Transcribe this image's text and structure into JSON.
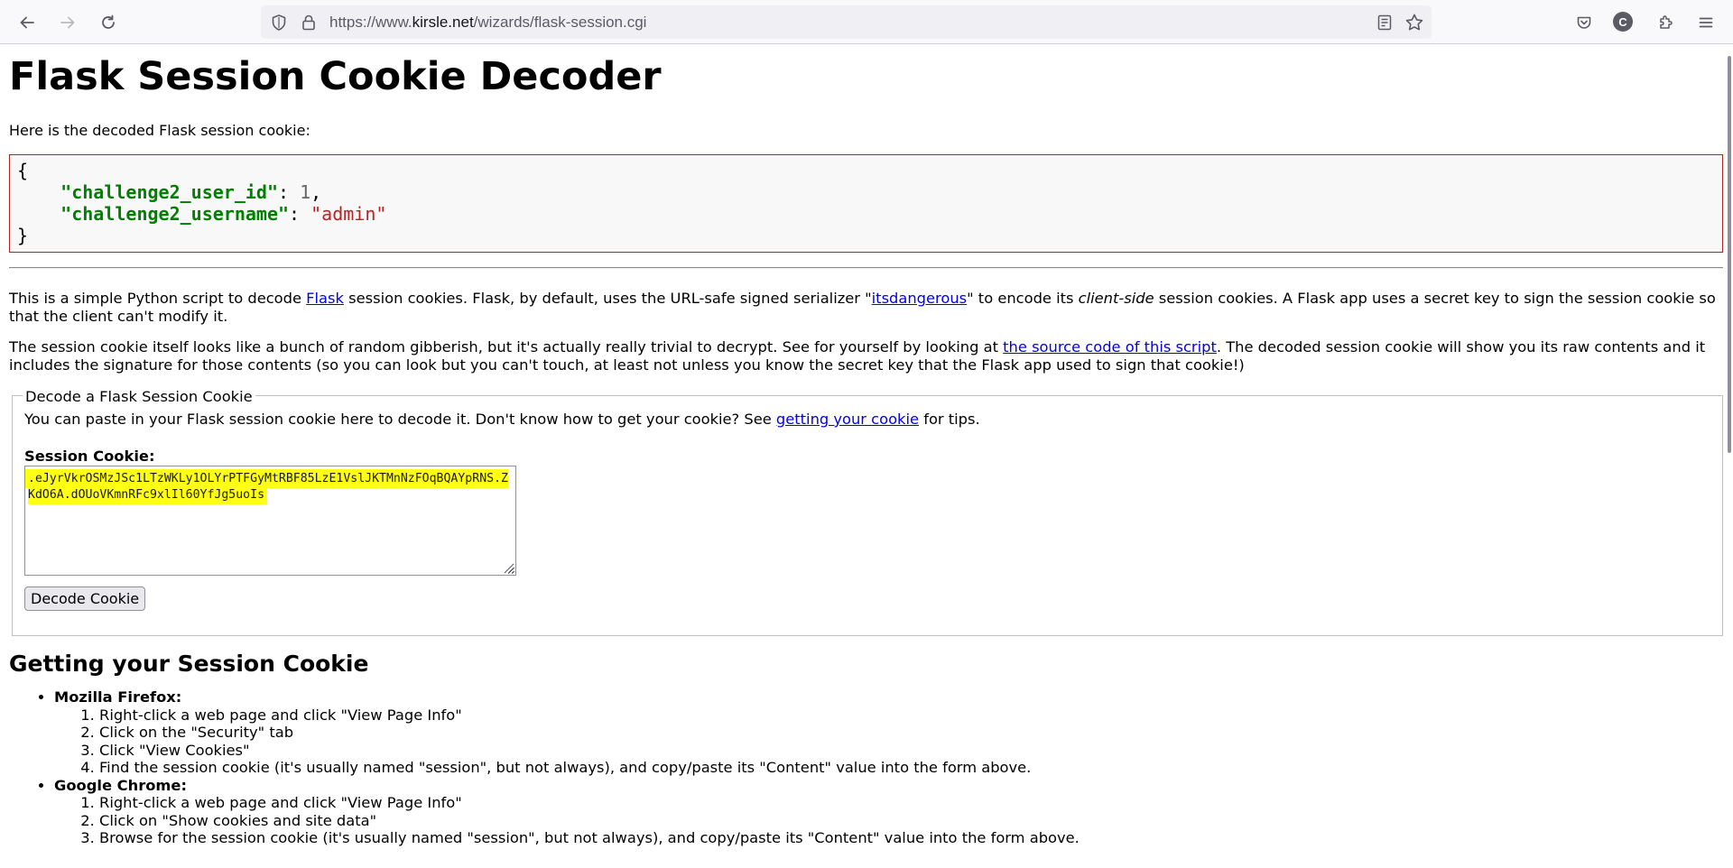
{
  "browser": {
    "url_prefix": "https://www.",
    "url_host": "kirsle.net",
    "url_path": "/wizards/flask-session.cgi",
    "avatar_letter": "C",
    "icons": [
      "back-icon",
      "forward-icon",
      "reload-icon",
      "shield-icon",
      "lock-icon",
      "reader-view-icon",
      "bookmark-star-icon",
      "pocket-icon",
      "account-avatar-icon",
      "extensions-icon",
      "menu-icon"
    ]
  },
  "page": {
    "title": "Flask Session Cookie Decoder",
    "intro": "Here is the decoded Flask session cookie:",
    "json": {
      "open": "{",
      "close": "}",
      "rows": [
        {
          "key": "\"challenge2_user_id\"",
          "sep": ": ",
          "value": "1",
          "trail": ",",
          "type": "num"
        },
        {
          "key": "\"challenge2_username\"",
          "sep": ": ",
          "value": "\"admin\"",
          "trail": "",
          "type": "str"
        }
      ]
    },
    "para1": {
      "t1": "This is a simple Python script to decode ",
      "link1": "Flask",
      "t2": " session cookies. Flask, by default, uses the URL-safe signed serializer \"",
      "link2": "itsdangerous",
      "t3": "\" to encode its ",
      "em": "client-side",
      "t4": " session cookies. A Flask app uses a secret key to sign the session cookie so that the client can't modify it."
    },
    "para2": {
      "t1": "The session cookie itself looks like a bunch of random gibberish, but it's actually really trivial to decrypt. See for yourself by looking at ",
      "link": "the source code of this script",
      "t2": ". The decoded session cookie will show you its raw contents and it includes the signature for those contents (so you can look but you can't touch, at least not unless you know the secret key that the Flask app used to sign that cookie!)"
    },
    "form": {
      "legend": "Decode a Flask Session Cookie",
      "tip_pre": "You can paste in your Flask session cookie here to decode it. Don't know how to get your cookie? See ",
      "tip_link": "getting your cookie",
      "tip_post": " for tips.",
      "label": "Session Cookie:",
      "cookie_value": ".eJyrVkrOSMzJSc1LTzWKLy1OLYrPTFGyMtRBF85LzE1VslJKTMnNzFOqBQAYpRNS.ZKdO6A.dOUoVKmnRFc9xlIl60YfJg5uoIs",
      "button": "Decode Cookie"
    },
    "help": {
      "heading": "Getting your Session Cookie",
      "browsers": [
        {
          "name": "Mozilla Firefox:",
          "steps": [
            "Right-click a web page and click \"View Page Info\"",
            "Click on the \"Security\" tab",
            "Click \"View Cookies\"",
            "Find the session cookie (it's usually named \"session\", but not always), and copy/paste its \"Content\" value into the form above."
          ]
        },
        {
          "name": "Google Chrome:",
          "steps": [
            "Right-click a web page and click \"View Page Info\"",
            "Click on \"Show cookies and site data\"",
            "Browse for the session cookie (it's usually named \"session\", but not always), and copy/paste its \"Content\" value into the form above."
          ]
        }
      ]
    }
  }
}
